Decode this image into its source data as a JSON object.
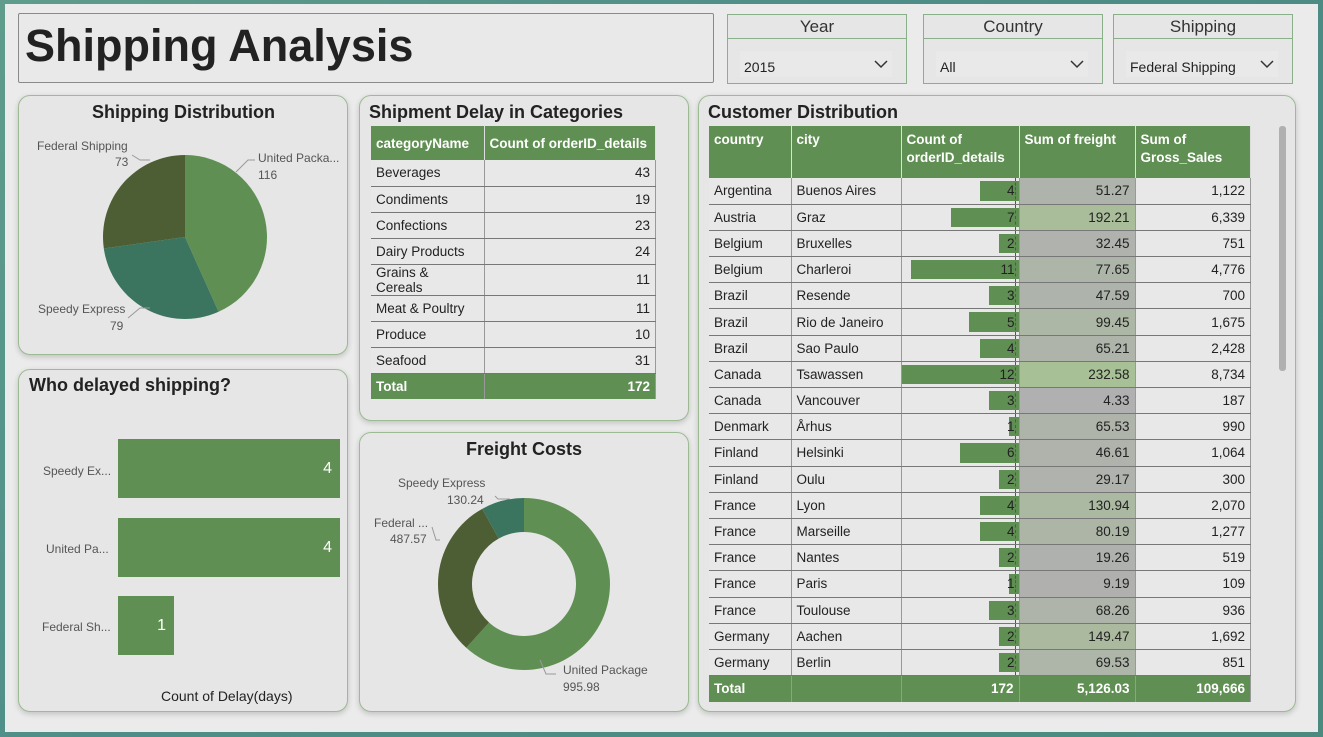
{
  "page": {
    "title": "Shipping Analysis"
  },
  "slicers": [
    {
      "label": "Year",
      "value": "2015"
    },
    {
      "label": "Country",
      "value": "All"
    },
    {
      "label": "Shipping",
      "value": "Federal Shipping"
    }
  ],
  "shipping_distribution": {
    "title": "Shipping Distribution",
    "labels": [
      {
        "name": "Federal Shipping",
        "value": "73"
      },
      {
        "name": "United Packa...",
        "value": "116"
      },
      {
        "name": "Speedy Express",
        "value": "79"
      }
    ]
  },
  "delayed": {
    "title": "Who delayed shipping?",
    "xlabel": "Count of Delay(days)",
    "bars": [
      {
        "label": "Speedy Ex...",
        "value": "4"
      },
      {
        "label": "United Pa...",
        "value": "4"
      },
      {
        "label": "Federal Sh...",
        "value": "1"
      }
    ]
  },
  "categories": {
    "title": "Shipment Delay in Categories",
    "headers": [
      "categoryName",
      "Count of orderID_details"
    ],
    "rows": [
      [
        "Beverages",
        "43"
      ],
      [
        "Condiments",
        "19"
      ],
      [
        "Confections",
        "23"
      ],
      [
        "Dairy Products",
        "24"
      ],
      [
        "Grains & Cereals",
        "11"
      ],
      [
        "Meat & Poultry",
        "11"
      ],
      [
        "Produce",
        "10"
      ],
      [
        "Seafood",
        "31"
      ]
    ],
    "total_label": "Total",
    "total_value": "172"
  },
  "freight": {
    "title": "Freight Costs",
    "labels": [
      {
        "name": "Speedy Express",
        "value": "130.24"
      },
      {
        "name": "Federal ...",
        "value": "487.57"
      },
      {
        "name": "United Package",
        "value": "995.98"
      }
    ]
  },
  "customers": {
    "title": "Customer Distribution",
    "headers": [
      "country",
      "city",
      "Count of orderID_details",
      "Sum of freight",
      "Sum of Gross_Sales"
    ],
    "rows": [
      [
        "Argentina",
        "Buenos Aires",
        "4",
        "51.27",
        "1,122"
      ],
      [
        "Austria",
        "Graz",
        "7",
        "192.21",
        "6,339"
      ],
      [
        "Belgium",
        "Bruxelles",
        "2",
        "32.45",
        "751"
      ],
      [
        "Belgium",
        "Charleroi",
        "11",
        "77.65",
        "4,776"
      ],
      [
        "Brazil",
        "Resende",
        "3",
        "47.59",
        "700"
      ],
      [
        "Brazil",
        "Rio de Janeiro",
        "5",
        "99.45",
        "1,675"
      ],
      [
        "Brazil",
        "Sao Paulo",
        "4",
        "65.21",
        "2,428"
      ],
      [
        "Canada",
        "Tsawassen",
        "12",
        "232.58",
        "8,734"
      ],
      [
        "Canada",
        "Vancouver",
        "3",
        "4.33",
        "187"
      ],
      [
        "Denmark",
        "Århus",
        "1",
        "65.53",
        "990"
      ],
      [
        "Finland",
        "Helsinki",
        "6",
        "46.61",
        "1,064"
      ],
      [
        "Finland",
        "Oulu",
        "2",
        "29.17",
        "300"
      ],
      [
        "France",
        "Lyon",
        "4",
        "130.94",
        "2,070"
      ],
      [
        "France",
        "Marseille",
        "4",
        "80.19",
        "1,277"
      ],
      [
        "France",
        "Nantes",
        "2",
        "19.26",
        "519"
      ],
      [
        "France",
        "Paris",
        "1",
        "9.19",
        "109"
      ],
      [
        "France",
        "Toulouse",
        "3",
        "68.26",
        "936"
      ],
      [
        "Germany",
        "Aachen",
        "2",
        "149.47",
        "1,692"
      ],
      [
        "Germany",
        "Berlin",
        "2",
        "69.53",
        "851"
      ]
    ],
    "total": [
      "Total",
      "",
      "172",
      "5,126.03",
      "109,666"
    ]
  },
  "chart_data": [
    {
      "type": "pie",
      "title": "Shipping Distribution",
      "categories": [
        "United Package",
        "Speedy Express",
        "Federal Shipping"
      ],
      "values": [
        116,
        79,
        73
      ],
      "colors": [
        "#608f53",
        "#3b755f",
        "#4e5e34"
      ]
    },
    {
      "type": "bar",
      "title": "Who delayed shipping?",
      "categories": [
        "Speedy Ex...",
        "United Pa...",
        "Federal Sh..."
      ],
      "values": [
        4,
        4,
        1
      ],
      "xlabel": "Count of Delay(days)",
      "orientation": "horizontal"
    },
    {
      "type": "pie",
      "title": "Freight Costs",
      "categories": [
        "United Package",
        "Federal ...",
        "Speedy Express"
      ],
      "values": [
        995.98,
        487.57,
        130.24
      ],
      "colors": [
        "#608f53",
        "#4e5e34",
        "#3b755f"
      ],
      "donut": true
    }
  ],
  "colors": {
    "accent": "#608f53",
    "dark": "#4e5e34",
    "teal": "#3b755f"
  }
}
